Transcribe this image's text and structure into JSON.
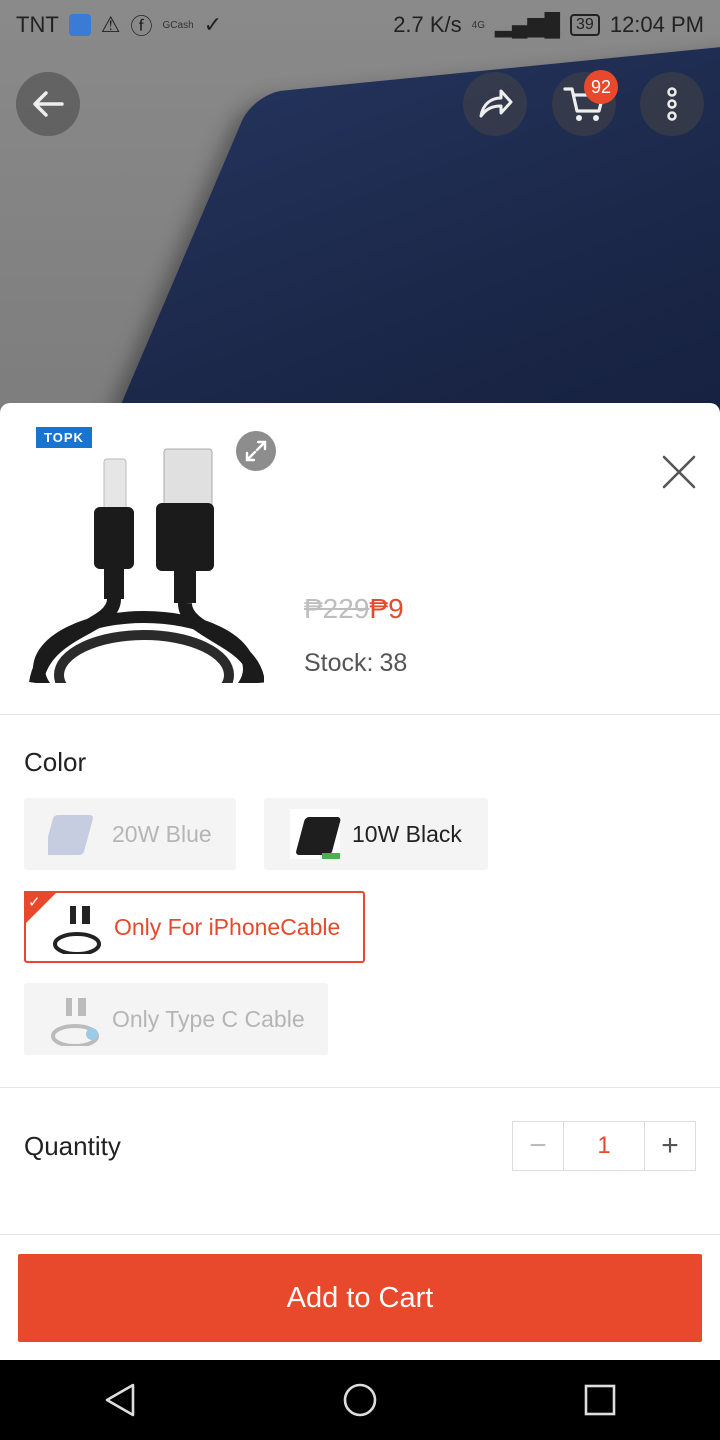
{
  "statusbar": {
    "carrier": "TNT",
    "app_small_label": "GCash",
    "speed": "2.7 K/s",
    "network": "4G",
    "battery": "39",
    "time": "12:04 PM"
  },
  "header": {
    "cart_count": "92"
  },
  "product": {
    "brand_tag": "TOPK",
    "old_price": "₱229",
    "new_price": "₱9",
    "stock_label": "Stock:",
    "stock_value": "38"
  },
  "color_section": {
    "title": "Color",
    "options": [
      {
        "label": "20W Blue",
        "state": "disabled"
      },
      {
        "label": "10W Black",
        "state": "available"
      },
      {
        "label": "Only For iPhoneCable",
        "state": "selected"
      },
      {
        "label": "Only Type C Cable",
        "state": "disabled"
      }
    ]
  },
  "quantity": {
    "title": "Quantity",
    "value": "1",
    "minus": "−",
    "plus": "+"
  },
  "actions": {
    "add_to_cart": "Add to Cart"
  },
  "colors": {
    "accent": "#e8492c",
    "disabled_text": "#b5b5b5",
    "chip_bg": "#f4f4f4"
  }
}
